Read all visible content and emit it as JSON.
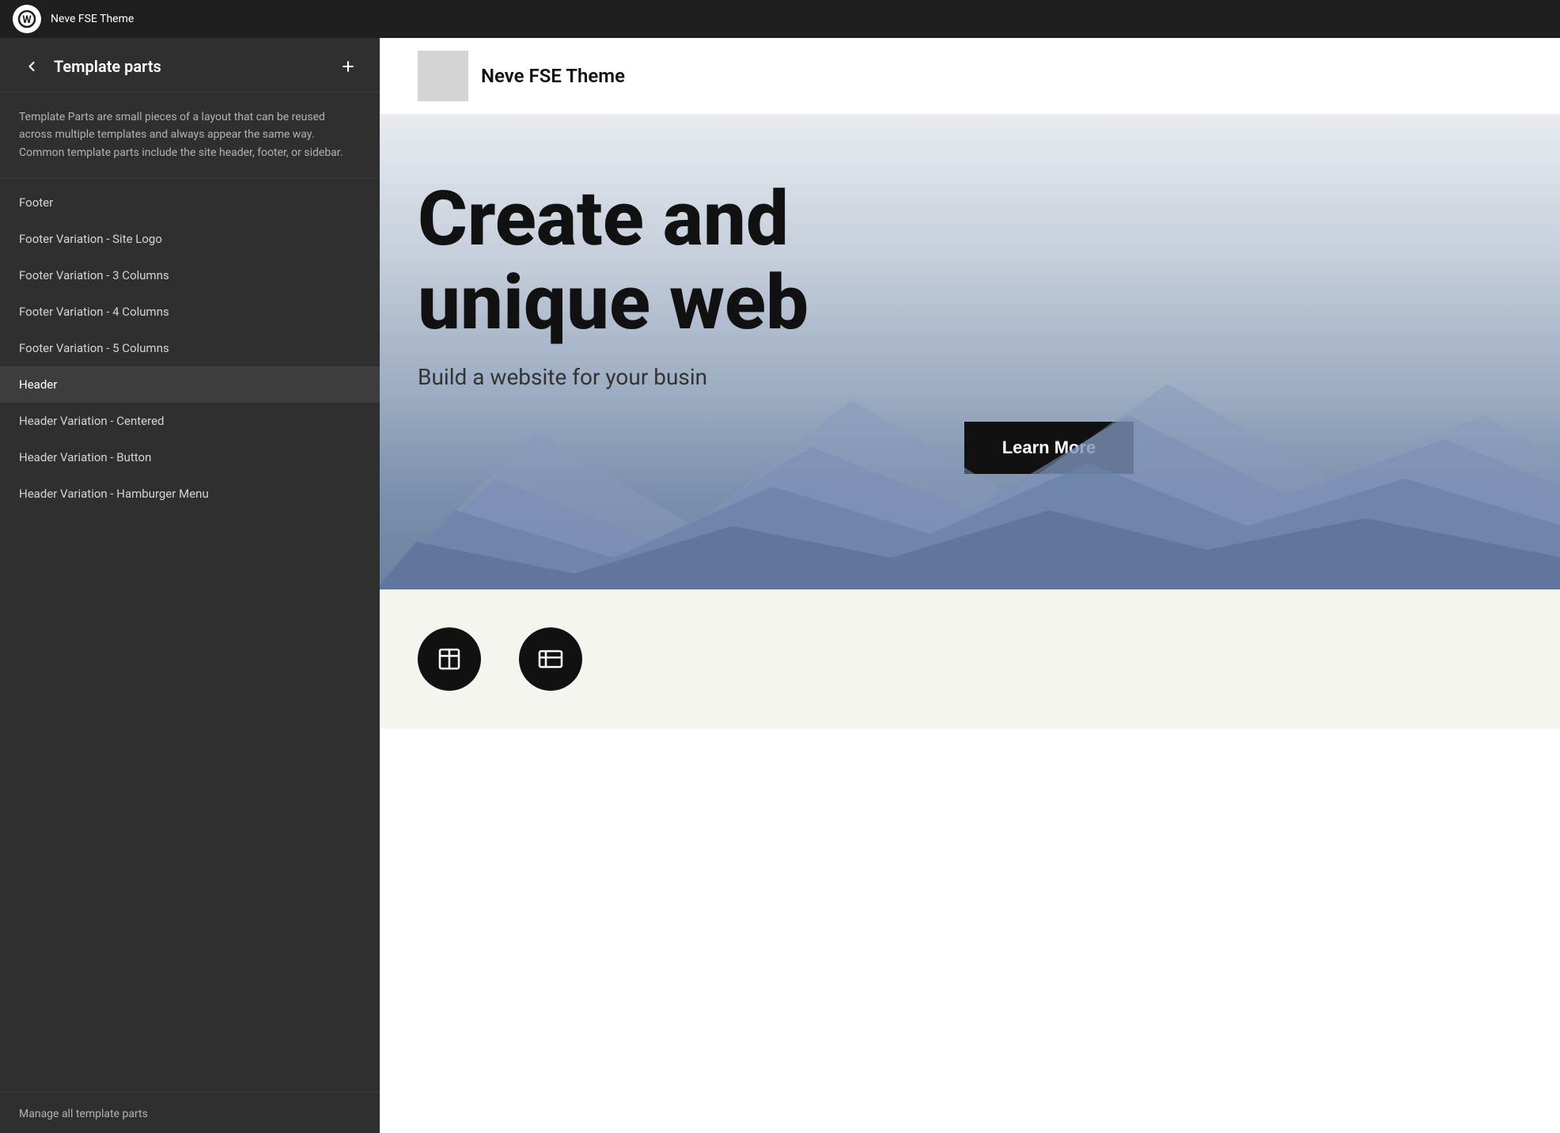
{
  "topbar": {
    "title": "Neve FSE Theme",
    "logo_label": "WordPress"
  },
  "sidebar": {
    "title": "Template parts",
    "description": "Template Parts are small pieces of a layout that can be reused across multiple templates and always appear the same way. Common template parts include the site header, footer, or sidebar.",
    "back_label": "Back",
    "add_label": "Add",
    "items": [
      {
        "id": "footer",
        "label": "Footer",
        "active": false
      },
      {
        "id": "footer-site-logo",
        "label": "Footer Variation - Site Logo",
        "active": false
      },
      {
        "id": "footer-3-columns",
        "label": "Footer Variation - 3 Columns",
        "active": false
      },
      {
        "id": "footer-4-columns",
        "label": "Footer Variation - 4 Columns",
        "active": false
      },
      {
        "id": "footer-5-columns",
        "label": "Footer Variation - 5 Columns",
        "active": false
      },
      {
        "id": "header",
        "label": "Header",
        "active": true
      },
      {
        "id": "header-centered",
        "label": "Header Variation - Centered",
        "active": false
      },
      {
        "id": "header-button",
        "label": "Header Variation - Button",
        "active": false
      },
      {
        "id": "header-hamburger",
        "label": "Header Variation - Hamburger Menu",
        "active": false
      }
    ],
    "manage_link": "Manage all template parts"
  },
  "preview": {
    "site_name": "Neve FSE Theme",
    "hero_title": "Create and",
    "hero_title_line2": "unique web",
    "hero_subtitle": "Build a website for your busin",
    "hero_button": "Learn More"
  }
}
